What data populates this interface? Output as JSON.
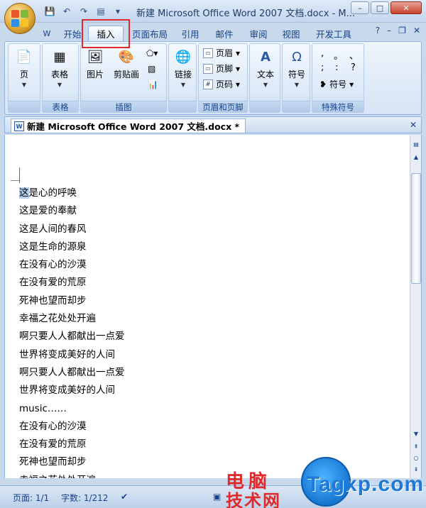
{
  "window": {
    "title": "新建 Microsoft Office Word 2007 文档.docx - M...",
    "min": "–",
    "max": "□",
    "close": "✕"
  },
  "qat": {
    "save": "💾",
    "undo": "↶",
    "redo": "↷",
    "print": "▤",
    "more": "▾"
  },
  "tabs": [
    "开始",
    "插入",
    "页面布局",
    "引用",
    "邮件",
    "审阅",
    "视图",
    "开发工具"
  ],
  "tab_icons": {
    "help": "?",
    "min": "–",
    "restore": "❐",
    "close": "✕"
  },
  "ribbon": {
    "groups": {
      "pages": {
        "label": "",
        "button": "页"
      },
      "tables": {
        "label": "表格",
        "button": "表格"
      },
      "illustrations": {
        "label": "插图",
        "picture": "图片",
        "clipart": "剪贴画"
      },
      "links": {
        "label": "",
        "button": "链接"
      },
      "header_footer": {
        "label": "页眉和页脚",
        "header": "页眉",
        "footer": "页脚",
        "page_number": "页码"
      },
      "text": {
        "label": "",
        "button": "文本"
      },
      "symbols": {
        "label": "",
        "button": "符号"
      },
      "special": {
        "label": "特殊符号",
        "button": "符号",
        "chars": [
          ",",
          "。",
          "、",
          ";",
          ":",
          "?"
        ]
      }
    }
  },
  "doc_tab": {
    "title": "新建 Microsoft Office Word 2007 文档.docx *",
    "close": "✕"
  },
  "document": {
    "lines": [
      "这是心的呼唤",
      "这是爱的奉献",
      "这是人间的春风",
      "这是生命的源泉",
      "在没有心的沙漠",
      "在没有爱的荒原",
      "死神也望而却步",
      "幸福之花处处开遍",
      "啊只要人人都献出一点爱",
      "世界将变成美好的人间",
      "啊只要人人都献出一点爱",
      "世界将变成美好的人间",
      "music……",
      "在没有心的沙漠",
      "在没有爱的荒原",
      "死神也望而却步",
      "幸福之花处处开遍"
    ]
  },
  "status": {
    "page": "页面: 1/1",
    "words": "字数: 1/212"
  },
  "watermark": {
    "line1": "电脑",
    "line2": "技术网",
    "brand": "Tagxp.com"
  }
}
